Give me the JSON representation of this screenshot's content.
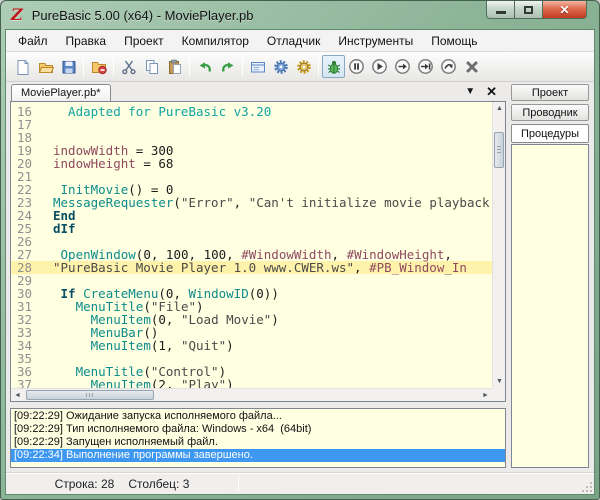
{
  "window": {
    "title": "PureBasic 5.00 (x64) - MoviePlayer.pb"
  },
  "menu_bar": {
    "items": [
      "Файл",
      "Правка",
      "Проект",
      "Компилятор",
      "Отладчик",
      "Инструменты",
      "Помощь"
    ]
  },
  "toolbar": {
    "icons": [
      "new-file",
      "open-file",
      "save-file",
      "close-file",
      "cut",
      "copy",
      "paste",
      "undo",
      "redo",
      "form-designer",
      "compile-run",
      "compiler-options",
      "debugger-toggle",
      "pause",
      "run-continue",
      "step",
      "step-over",
      "step-out",
      "kill-program"
    ],
    "debugger_toggle_pressed": true
  },
  "tab_bar": {
    "active_tab": "MoviePlayer.pb*"
  },
  "side_panel": {
    "tabs": [
      {
        "label": "Проект",
        "active": false
      },
      {
        "label": "Проводник",
        "active": false
      },
      {
        "label": "Процедуры",
        "active": true
      }
    ]
  },
  "editor": {
    "current_line": 28,
    "lines": [
      {
        "no": 16,
        "segments": [
          {
            "c": "comment",
            "t": "  Adapted for PureBasic v3.20"
          }
        ]
      },
      {
        "no": 17,
        "segments": []
      },
      {
        "no": 18,
        "segments": []
      },
      {
        "no": 19,
        "segments": [
          {
            "c": "const",
            "t": "indowWidth"
          },
          {
            "c": "plain",
            "t": " = "
          },
          {
            "c": "num",
            "t": "300"
          }
        ]
      },
      {
        "no": 20,
        "segments": [
          {
            "c": "const",
            "t": "indowHeight"
          },
          {
            "c": "plain",
            "t": " = "
          },
          {
            "c": "num",
            "t": "68"
          }
        ]
      },
      {
        "no": 21,
        "segments": []
      },
      {
        "no": 22,
        "segments": [
          {
            "c": "plain",
            "t": " "
          },
          {
            "c": "func",
            "t": "InitMovie"
          },
          {
            "c": "plain",
            "t": "() = "
          },
          {
            "c": "num",
            "t": "0"
          }
        ]
      },
      {
        "no": 23,
        "segments": [
          {
            "c": "func",
            "t": "MessageRequester"
          },
          {
            "c": "plain",
            "t": "("
          },
          {
            "c": "str",
            "t": "\"Error\""
          },
          {
            "c": "plain",
            "t": ", "
          },
          {
            "c": "str",
            "t": "\"Can't initialize movie playback"
          }
        ]
      },
      {
        "no": 24,
        "segments": [
          {
            "c": "kw",
            "t": "End"
          }
        ]
      },
      {
        "no": 25,
        "segments": [
          {
            "c": "kw",
            "t": "dIf"
          }
        ]
      },
      {
        "no": 26,
        "segments": []
      },
      {
        "no": 27,
        "segments": [
          {
            "c": "plain",
            "t": " "
          },
          {
            "c": "func",
            "t": "OpenWindow"
          },
          {
            "c": "plain",
            "t": "("
          },
          {
            "c": "num",
            "t": "0"
          },
          {
            "c": "plain",
            "t": ", "
          },
          {
            "c": "num",
            "t": "100"
          },
          {
            "c": "plain",
            "t": ", "
          },
          {
            "c": "num",
            "t": "100"
          },
          {
            "c": "plain",
            "t": ", "
          },
          {
            "c": "const",
            "t": "#WindowWidth"
          },
          {
            "c": "plain",
            "t": ", "
          },
          {
            "c": "const",
            "t": "#WindowHeight"
          },
          {
            "c": "plain",
            "t": ","
          }
        ]
      },
      {
        "no": 28,
        "segments": [
          {
            "c": "str",
            "t": "\"PureBasic Movie Player 1.0 www.CWER.ws\""
          },
          {
            "c": "plain",
            "t": ", "
          },
          {
            "c": "const",
            "t": "#PB_Window_In"
          }
        ]
      },
      {
        "no": 29,
        "segments": []
      },
      {
        "no": 30,
        "segments": [
          {
            "c": "plain",
            "t": " "
          },
          {
            "c": "kw",
            "t": "If"
          },
          {
            "c": "plain",
            "t": " "
          },
          {
            "c": "func",
            "t": "CreateMenu"
          },
          {
            "c": "plain",
            "t": "("
          },
          {
            "c": "num",
            "t": "0"
          },
          {
            "c": "plain",
            "t": ", "
          },
          {
            "c": "func",
            "t": "WindowID"
          },
          {
            "c": "plain",
            "t": "("
          },
          {
            "c": "num",
            "t": "0"
          },
          {
            "c": "plain",
            "t": "))"
          }
        ]
      },
      {
        "no": 31,
        "segments": [
          {
            "c": "plain",
            "t": "   "
          },
          {
            "c": "func",
            "t": "MenuTitle"
          },
          {
            "c": "plain",
            "t": "("
          },
          {
            "c": "str",
            "t": "\"File\""
          },
          {
            "c": "plain",
            "t": ")"
          }
        ]
      },
      {
        "no": 32,
        "segments": [
          {
            "c": "plain",
            "t": "     "
          },
          {
            "c": "func",
            "t": "MenuItem"
          },
          {
            "c": "plain",
            "t": "("
          },
          {
            "c": "num",
            "t": "0"
          },
          {
            "c": "plain",
            "t": ", "
          },
          {
            "c": "str",
            "t": "\"Load Movie\""
          },
          {
            "c": "plain",
            "t": ")"
          }
        ]
      },
      {
        "no": 33,
        "segments": [
          {
            "c": "plain",
            "t": "     "
          },
          {
            "c": "func",
            "t": "MenuBar"
          },
          {
            "c": "plain",
            "t": "()"
          }
        ]
      },
      {
        "no": 34,
        "segments": [
          {
            "c": "plain",
            "t": "     "
          },
          {
            "c": "func",
            "t": "MenuItem"
          },
          {
            "c": "plain",
            "t": "("
          },
          {
            "c": "num",
            "t": "1"
          },
          {
            "c": "plain",
            "t": ", "
          },
          {
            "c": "str",
            "t": "\"Quit\""
          },
          {
            "c": "plain",
            "t": ")"
          }
        ]
      },
      {
        "no": 35,
        "segments": []
      },
      {
        "no": 36,
        "segments": [
          {
            "c": "plain",
            "t": "   "
          },
          {
            "c": "func",
            "t": "MenuTitle"
          },
          {
            "c": "plain",
            "t": "("
          },
          {
            "c": "str",
            "t": "\"Control\""
          },
          {
            "c": "plain",
            "t": ")"
          }
        ]
      },
      {
        "no": 37,
        "segments": [
          {
            "c": "plain",
            "t": "     "
          },
          {
            "c": "func",
            "t": "MenuItem"
          },
          {
            "c": "plain",
            "t": "("
          },
          {
            "c": "num",
            "t": "2"
          },
          {
            "c": "plain",
            "t": ", "
          },
          {
            "c": "str",
            "t": "\"Play\""
          },
          {
            "c": "plain",
            "t": ")"
          }
        ]
      }
    ]
  },
  "log": {
    "entries": [
      {
        "time": "[09:22:29]",
        "text": "Ожидание запуска исполняемого файла...",
        "selected": false
      },
      {
        "time": "[09:22:29]",
        "text": "Тип исполняемого файла: Windows - x64  (64bit)",
        "selected": false
      },
      {
        "time": "[09:22:29]",
        "text": "Запущен исполняемый файл.",
        "selected": false
      },
      {
        "time": "[09:22:34]",
        "text": "Выполнение программы завершено.",
        "selected": true
      }
    ]
  },
  "status_bar": {
    "line": "Строка: 28",
    "column": "Столбец: 3"
  },
  "colors": {
    "frame_green": "#8CB497",
    "editor_bg": "#FFFFE1",
    "current_line_bg": "#FFF3AC",
    "selection_blue": "#3E97F0",
    "comment": "#12A3A3",
    "keyword": "#0A4F63",
    "function": "#0E8B8B",
    "constant": "#8F4A60",
    "string": "#4A4A4A",
    "close_button_red": "#C23C22",
    "logo_red": "#C01818"
  }
}
